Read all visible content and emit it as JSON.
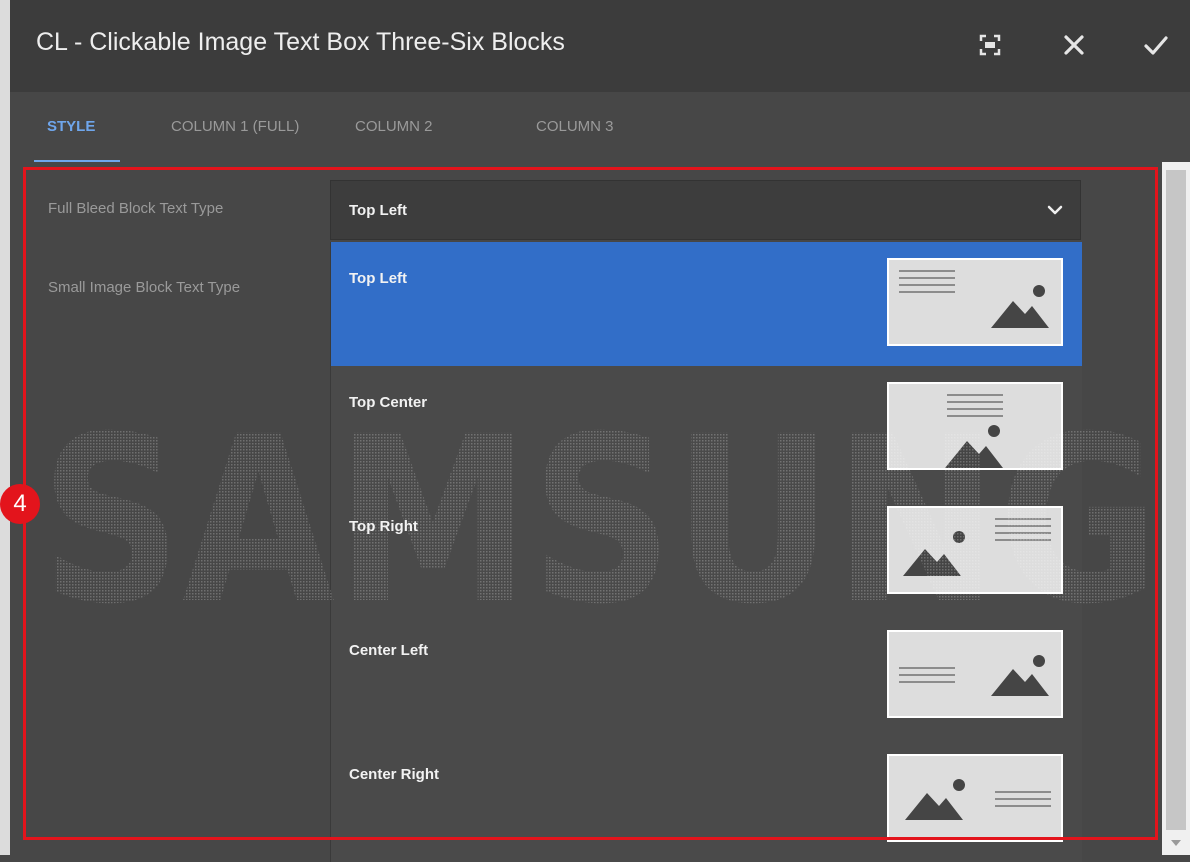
{
  "dialog": {
    "title": "CL - Clickable Image Text Box Three-Six Blocks"
  },
  "toolbar": {
    "fullscreen_icon": "fullscreen-icon",
    "close_icon": "close-icon",
    "done_icon": "checkmark-icon"
  },
  "tabs": [
    {
      "label": "STYLE",
      "active": true
    },
    {
      "label": "COLUMN 1 (FULL)",
      "active": false
    },
    {
      "label": "COLUMN 2",
      "active": false
    },
    {
      "label": "COLUMN 3",
      "active": false
    }
  ],
  "fields": {
    "full_bleed": {
      "label": "Full Bleed Block Text Type",
      "value": "Top Left"
    },
    "small_image": {
      "label": "Small Image Block Text Type"
    }
  },
  "dropdown": {
    "options": [
      {
        "label": "Top Left",
        "selected": true
      },
      {
        "label": "Top Center",
        "selected": false
      },
      {
        "label": "Top Right",
        "selected": false
      },
      {
        "label": "Center Left",
        "selected": false
      },
      {
        "label": "Center Right",
        "selected": false
      }
    ]
  },
  "watermark": {
    "text": "SAMSUNG"
  },
  "annotation": {
    "marker": "4"
  },
  "colors": {
    "accent": "#6fa6ec",
    "selected": "#326ec8",
    "highlight": "#e3141c"
  }
}
